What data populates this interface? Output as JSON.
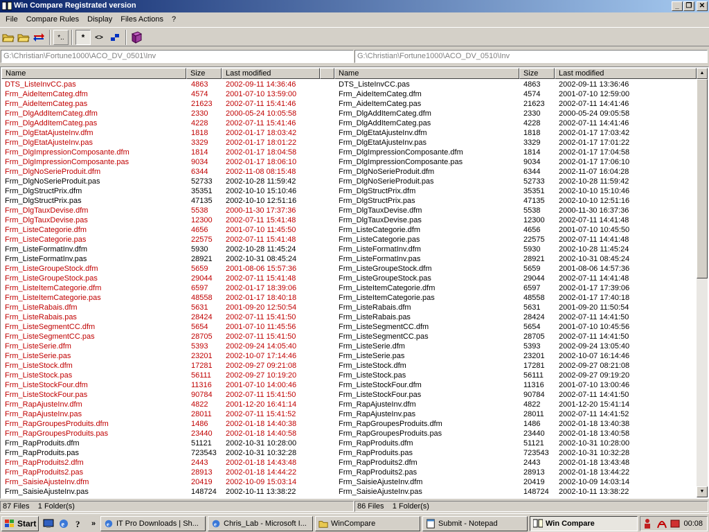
{
  "window": {
    "title": "Win Compare Registrated version",
    "min": "_",
    "restore": "❐",
    "close": "✕"
  },
  "menu": [
    "File",
    "Compare Rules",
    "Display",
    "Files Actions",
    "?"
  ],
  "toolbar": {
    "mask_label": "*..",
    "star_label": "*",
    "diff_label": "<>"
  },
  "left": {
    "path": "G:\\Christian\\Fortune1000\\ACO_DV_0501\\Inv",
    "headers": {
      "name": "Name",
      "size": "Size",
      "modified": "Last modified"
    },
    "status": {
      "files": "87 Files",
      "folders": "1 Folder(s)"
    }
  },
  "right": {
    "path": "G:\\Christian\\Fortune1000\\ACO_DV_0510\\Inv",
    "headers": {
      "name": "Name",
      "size": "Size",
      "modified": "Last modified"
    },
    "status": {
      "files": "86 Files",
      "folders": "1 Folder(s)"
    }
  },
  "rows": [
    {
      "name": "DTS_ListeInvCC.pas",
      "lsize": "4863",
      "ldate": "2002-09-11 14:36:46",
      "rsize": "4863",
      "rdate": "2002-09-11 13:36:46",
      "diff": true
    },
    {
      "name": "Frm_AideItemCateg.dfm",
      "lsize": "4574",
      "ldate": "2001-07-10 13:59:00",
      "rsize": "4574",
      "rdate": "2001-07-10 12:59:00",
      "diff": true
    },
    {
      "name": "Frm_AideItemCateg.pas",
      "lsize": "21623",
      "ldate": "2002-07-11 15:41:46",
      "rsize": "21623",
      "rdate": "2002-07-11 14:41:46",
      "diff": true
    },
    {
      "name": "Frm_DlgAddItemCateg.dfm",
      "lsize": "2330",
      "ldate": "2000-05-24 10:05:58",
      "rsize": "2330",
      "rdate": "2000-05-24 09:05:58",
      "diff": true
    },
    {
      "name": "Frm_DlgAddItemCateg.pas",
      "lsize": "4228",
      "ldate": "2002-07-11 15:41:46",
      "rsize": "4228",
      "rdate": "2002-07-11 14:41:46",
      "diff": true
    },
    {
      "name": "Frm_DlgEtatAjusteInv.dfm",
      "lsize": "1818",
      "ldate": "2002-01-17 18:03:42",
      "rsize": "1818",
      "rdate": "2002-01-17 17:03:42",
      "diff": true
    },
    {
      "name": "Frm_DlgEtatAjusteInv.pas",
      "lsize": "3329",
      "ldate": "2002-01-17 18:01:22",
      "rsize": "3329",
      "rdate": "2002-01-17 17:01:22",
      "diff": true
    },
    {
      "name": "Frm_DlgImpressionComposante.dfm",
      "lsize": "1814",
      "ldate": "2002-01-17 18:04:58",
      "rsize": "1814",
      "rdate": "2002-01-17 17:04:58",
      "diff": true
    },
    {
      "name": "Frm_DlgImpressionComposante.pas",
      "lsize": "9034",
      "ldate": "2002-01-17 18:06:10",
      "rsize": "9034",
      "rdate": "2002-01-17 17:06:10",
      "diff": true
    },
    {
      "name": "Frm_DlgNoSerieProduit.dfm",
      "lsize": "6344",
      "ldate": "2002-11-08 08:15:48",
      "rsize": "6344",
      "rdate": "2002-11-07 16:04:28",
      "diff": true
    },
    {
      "name": "Frm_DlgNoSerieProduit.pas",
      "lsize": "52733",
      "ldate": "2002-10-28 11:59:42",
      "rsize": "52733",
      "rdate": "2002-10-28 11:59:42",
      "diff": false
    },
    {
      "name": "Frm_DlgStructPrix.dfm",
      "lsize": "35351",
      "ldate": "2002-10-10 15:10:46",
      "rsize": "35351",
      "rdate": "2002-10-10 15:10:46",
      "diff": false
    },
    {
      "name": "Frm_DlgStructPrix.pas",
      "lsize": "47135",
      "ldate": "2002-10-10 12:51:16",
      "rsize": "47135",
      "rdate": "2002-10-10 12:51:16",
      "diff": false
    },
    {
      "name": "Frm_DlgTauxDevise.dfm",
      "lsize": "5538",
      "ldate": "2000-11-30 17:37:36",
      "rsize": "5538",
      "rdate": "2000-11-30 16:37:36",
      "diff": true
    },
    {
      "name": "Frm_DlgTauxDevise.pas",
      "lsize": "12300",
      "ldate": "2002-07-11 15:41:48",
      "rsize": "12300",
      "rdate": "2002-07-11 14:41:48",
      "diff": true
    },
    {
      "name": "Frm_ListeCategorie.dfm",
      "lsize": "4656",
      "ldate": "2001-07-10 11:45:50",
      "rsize": "4656",
      "rdate": "2001-07-10 10:45:50",
      "diff": true
    },
    {
      "name": "Frm_ListeCategorie.pas",
      "lsize": "22575",
      "ldate": "2002-07-11 15:41:48",
      "rsize": "22575",
      "rdate": "2002-07-11 14:41:48",
      "diff": true
    },
    {
      "name": "Frm_ListeFormatInv.dfm",
      "lsize": "5930",
      "ldate": "2002-10-28 11:45:24",
      "rsize": "5930",
      "rdate": "2002-10-28 11:45:24",
      "diff": false
    },
    {
      "name": "Frm_ListeFormatInv.pas",
      "lsize": "28921",
      "ldate": "2002-10-31 08:45:24",
      "rsize": "28921",
      "rdate": "2002-10-31 08:45:24",
      "diff": false
    },
    {
      "name": "Frm_ListeGroupeStock.dfm",
      "lsize": "5659",
      "ldate": "2001-08-06 15:57:36",
      "rsize": "5659",
      "rdate": "2001-08-06 14:57:36",
      "diff": true
    },
    {
      "name": "Frm_ListeGroupeStock.pas",
      "lsize": "29044",
      "ldate": "2002-07-11 15:41:48",
      "rsize": "29044",
      "rdate": "2002-07-11 14:41:48",
      "diff": true
    },
    {
      "name": "Frm_ListeItemCategorie.dfm",
      "lsize": "6597",
      "ldate": "2002-01-17 18:39:06",
      "rsize": "6597",
      "rdate": "2002-01-17 17:39:06",
      "diff": true
    },
    {
      "name": "Frm_ListeItemCategorie.pas",
      "lsize": "48558",
      "ldate": "2002-01-17 18:40:18",
      "rsize": "48558",
      "rdate": "2002-01-17 17:40:18",
      "diff": true
    },
    {
      "name": "Frm_ListeRabais.dfm",
      "lsize": "5631",
      "ldate": "2001-09-20 12:50:54",
      "rsize": "5631",
      "rdate": "2001-09-20 11:50:54",
      "diff": true
    },
    {
      "name": "Frm_ListeRabais.pas",
      "lsize": "28424",
      "ldate": "2002-07-11 15:41:50",
      "rsize": "28424",
      "rdate": "2002-07-11 14:41:50",
      "diff": true
    },
    {
      "name": "Frm_ListeSegmentCC.dfm",
      "lsize": "5654",
      "ldate": "2001-07-10 11:45:56",
      "rsize": "5654",
      "rdate": "2001-07-10 10:45:56",
      "diff": true
    },
    {
      "name": "Frm_ListeSegmentCC.pas",
      "lsize": "28705",
      "ldate": "2002-07-11 15:41:50",
      "rsize": "28705",
      "rdate": "2002-07-11 14:41:50",
      "diff": true
    },
    {
      "name": "Frm_ListeSerie.dfm",
      "lsize": "5393",
      "ldate": "2002-09-24 14:05:40",
      "rsize": "5393",
      "rdate": "2002-09-24 13:05:40",
      "diff": true
    },
    {
      "name": "Frm_ListeSerie.pas",
      "lsize": "23201",
      "ldate": "2002-10-07 17:14:46",
      "rsize": "23201",
      "rdate": "2002-10-07 16:14:46",
      "diff": true
    },
    {
      "name": "Frm_ListeStock.dfm",
      "lsize": "17281",
      "ldate": "2002-09-27 09:21:08",
      "rsize": "17281",
      "rdate": "2002-09-27 08:21:08",
      "diff": true
    },
    {
      "name": "Frm_ListeStock.pas",
      "lsize": "56111",
      "ldate": "2002-09-27 10:19:20",
      "rsize": "56111",
      "rdate": "2002-09-27 09:19:20",
      "diff": true
    },
    {
      "name": "Frm_ListeStockFour.dfm",
      "lsize": "11316",
      "ldate": "2001-07-10 14:00:46",
      "rsize": "11316",
      "rdate": "2001-07-10 13:00:46",
      "diff": true
    },
    {
      "name": "Frm_ListeStockFour.pas",
      "lsize": "90784",
      "ldate": "2002-07-11 15:41:50",
      "rsize": "90784",
      "rdate": "2002-07-11 14:41:50",
      "diff": true
    },
    {
      "name": "Frm_RapAjusteInv.dfm",
      "lsize": "4822",
      "ldate": "2001-12-20 16:41:14",
      "rsize": "4822",
      "rdate": "2001-12-20 15:41:14",
      "diff": true
    },
    {
      "name": "Frm_RapAjusteInv.pas",
      "lsize": "28011",
      "ldate": "2002-07-11 15:41:52",
      "rsize": "28011",
      "rdate": "2002-07-11 14:41:52",
      "diff": true
    },
    {
      "name": "Frm_RapGroupesProduits.dfm",
      "lsize": "1486",
      "ldate": "2002-01-18 14:40:38",
      "rsize": "1486",
      "rdate": "2002-01-18 13:40:38",
      "diff": true
    },
    {
      "name": "Frm_RapGroupesProduits.pas",
      "lsize": "23440",
      "ldate": "2002-01-18 14:40:58",
      "rsize": "23440",
      "rdate": "2002-01-18 13:40:58",
      "diff": true
    },
    {
      "name": "Frm_RapProduits.dfm",
      "lsize": "51121",
      "ldate": "2002-10-31 10:28:00",
      "rsize": "51121",
      "rdate": "2002-10-31 10:28:00",
      "diff": false
    },
    {
      "name": "Frm_RapProduits.pas",
      "lsize": "723543",
      "ldate": "2002-10-31 10:32:28",
      "rsize": "723543",
      "rdate": "2002-10-31 10:32:28",
      "diff": false
    },
    {
      "name": "Frm_RapProduits2.dfm",
      "lsize": "2443",
      "ldate": "2002-01-18 14:43:48",
      "rsize": "2443",
      "rdate": "2002-01-18 13:43:48",
      "diff": true
    },
    {
      "name": "Frm_RapProduits2.pas",
      "lsize": "28913",
      "ldate": "2002-01-18 14:44:22",
      "rsize": "28913",
      "rdate": "2002-01-18 13:44:22",
      "diff": true
    },
    {
      "name": "Frm_SaisieAjusteInv.dfm",
      "lsize": "20419",
      "ldate": "2002-10-09 15:03:14",
      "rsize": "20419",
      "rdate": "2002-10-09 14:03:14",
      "diff": true
    },
    {
      "name": "Frm_SaisieAjusteInv.pas",
      "lsize": "148724",
      "ldate": "2002-10-11 13:38:22",
      "rsize": "148724",
      "rdate": "2002-10-11 13:38:22",
      "diff": false
    }
  ],
  "colors": {
    "diff": "#c00000",
    "titlebar": "#0a246a"
  },
  "taskbar": {
    "start": "Start",
    "more": "»",
    "tasks": [
      {
        "label": "IT Pro Downloads | Sh...",
        "icon": "ie-icon"
      },
      {
        "label": "Chris_Lab - Microsoft I...",
        "icon": "ie-icon"
      },
      {
        "label": "WinCompare",
        "icon": "folder-icon"
      },
      {
        "label": "Submit - Notepad",
        "icon": "notepad-icon"
      },
      {
        "label": "Win Compare",
        "icon": "wincompare-icon"
      }
    ],
    "clock": "00:08"
  }
}
